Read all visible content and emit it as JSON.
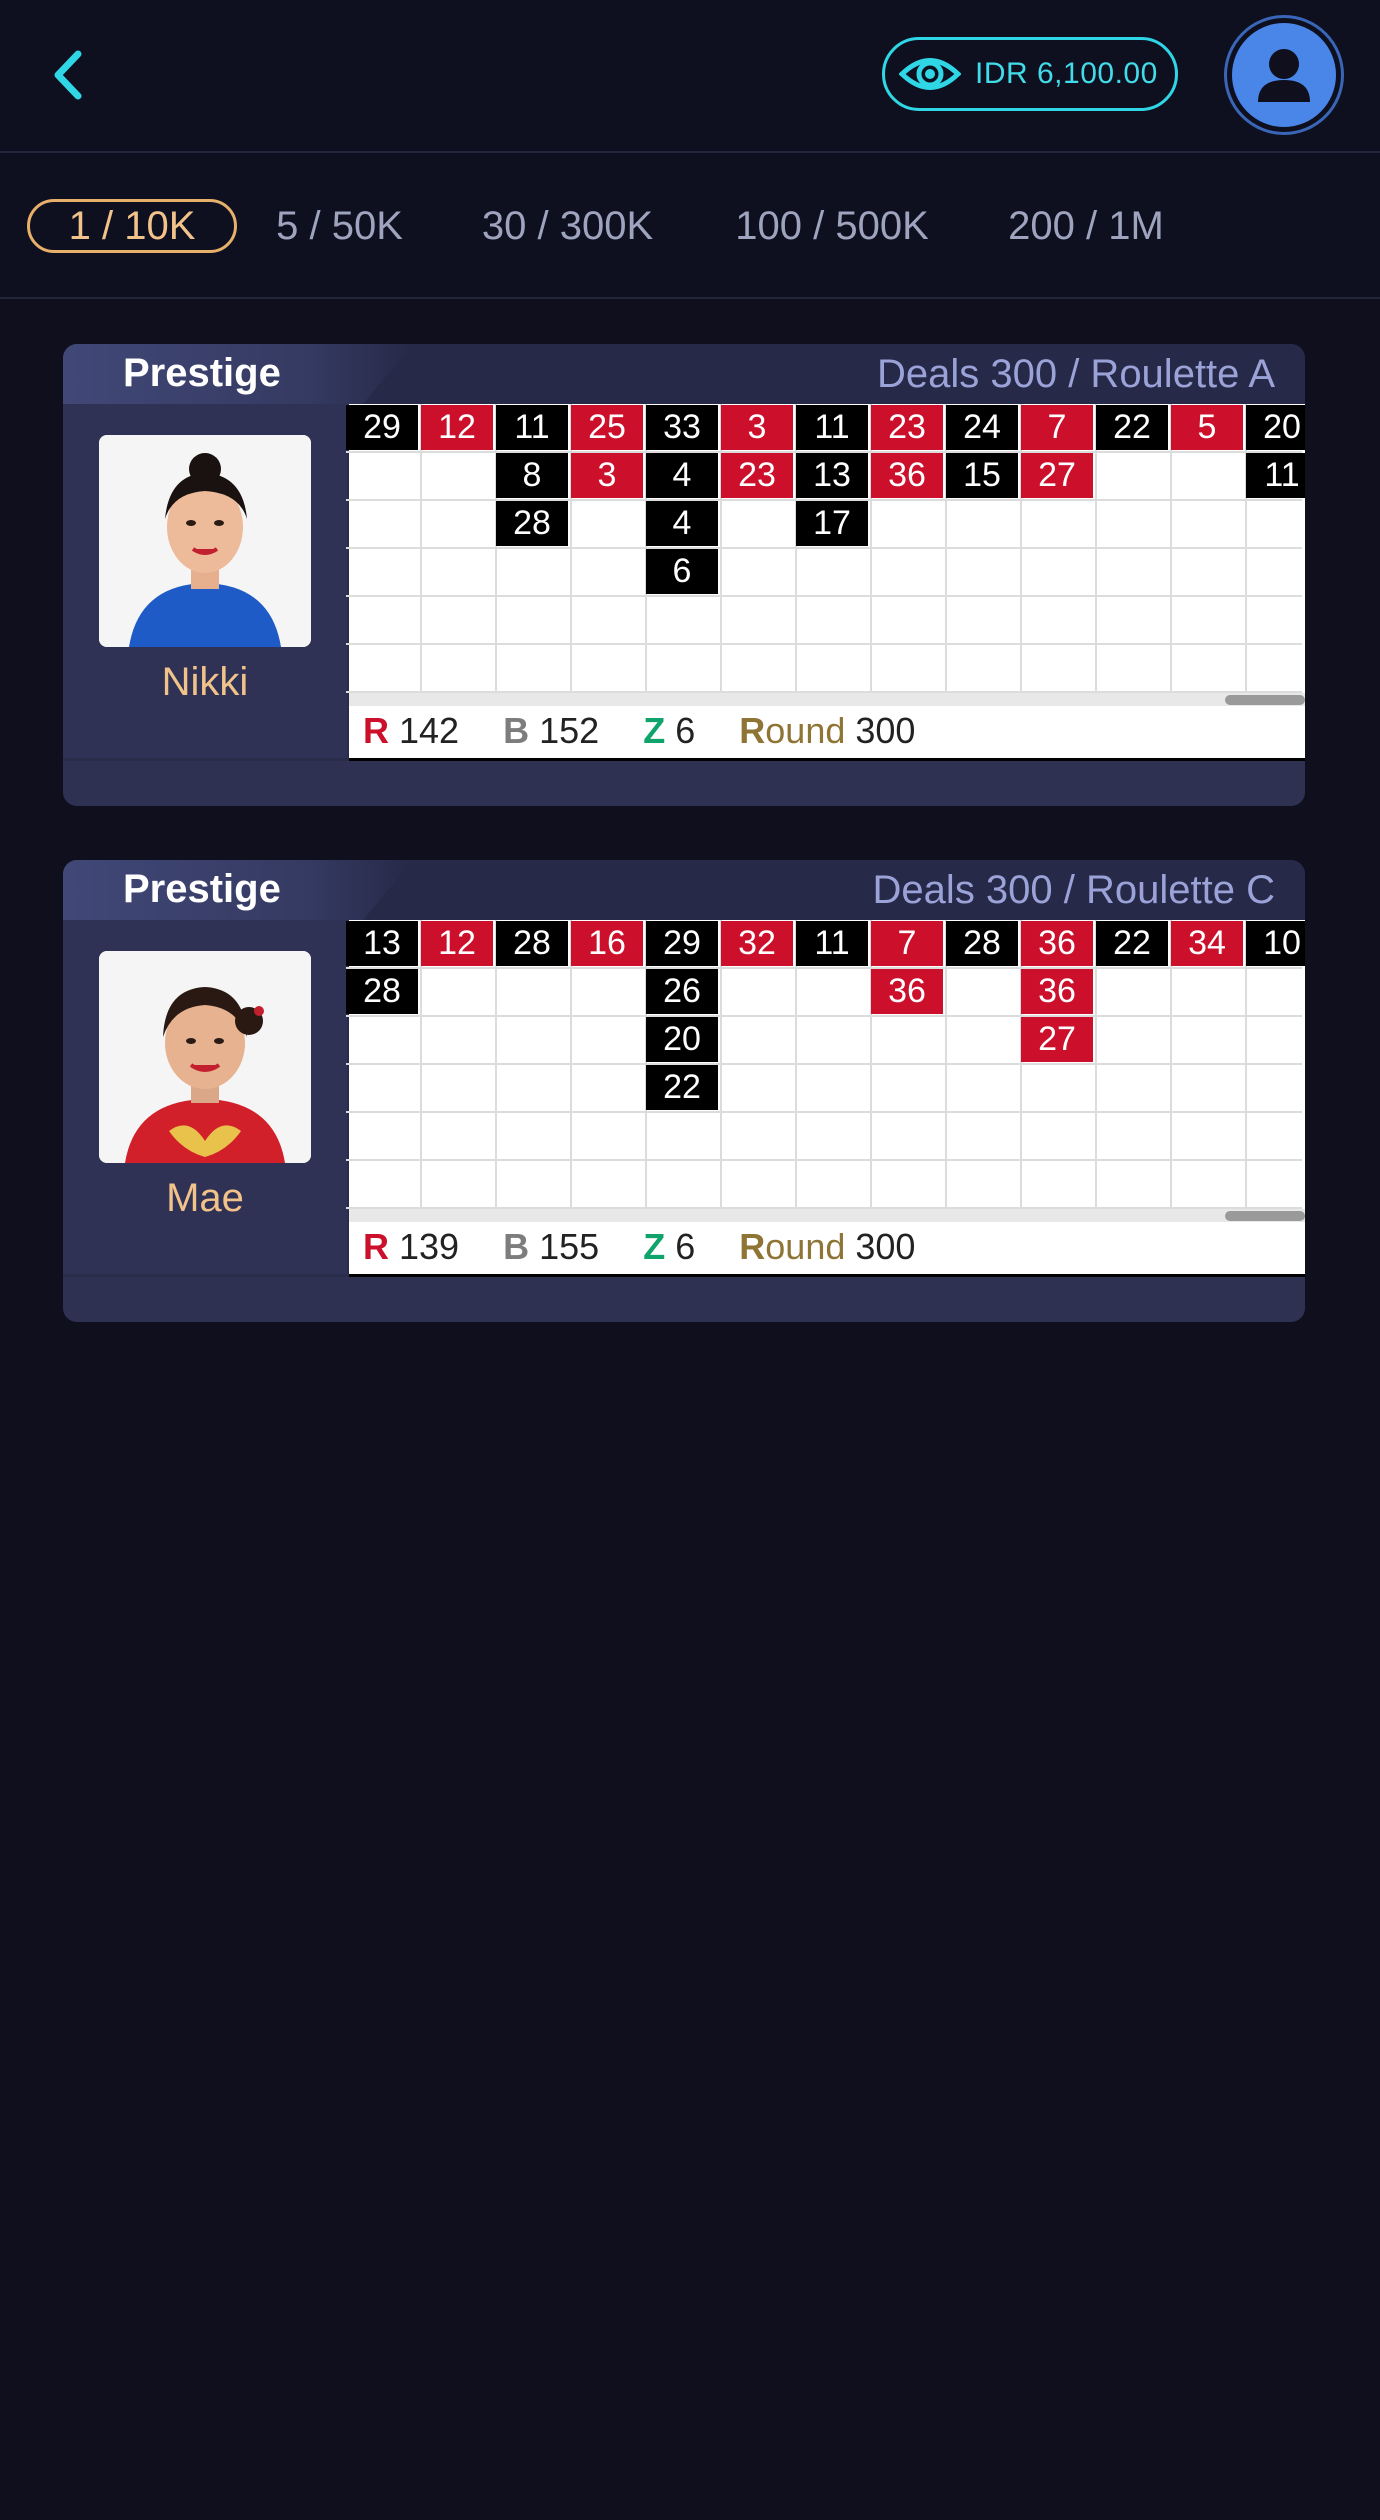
{
  "header": {
    "balance": "IDR  6,100.00"
  },
  "tabs": [
    {
      "label": "1 / 10K",
      "active": true
    },
    {
      "label": "5 / 50K",
      "active": false
    },
    {
      "label": "30 / 300K",
      "active": false
    },
    {
      "label": "100 / 500K",
      "active": false
    },
    {
      "label": "200 / 1M",
      "active": false
    }
  ],
  "tables": [
    {
      "brand": "Prestige",
      "deals": "Deals 300 / Roulette A",
      "dealer": "Nikki",
      "stats": {
        "r_label": "R",
        "r": "142",
        "b_label": "B",
        "b": "152",
        "z_label": "Z",
        "z": "6",
        "round_initial": "R",
        "round_rest": "ound",
        "round": "300"
      },
      "scroll_fraction": 1.0,
      "columns": [
        [
          {
            "n": "29",
            "c": "black"
          }
        ],
        [
          {
            "n": "12",
            "c": "red"
          }
        ],
        [
          {
            "n": "11",
            "c": "black"
          },
          {
            "n": "8",
            "c": "black"
          },
          {
            "n": "28",
            "c": "black"
          }
        ],
        [
          {
            "n": "25",
            "c": "red"
          },
          {
            "n": "3",
            "c": "red"
          }
        ],
        [
          {
            "n": "33",
            "c": "black"
          },
          {
            "n": "4",
            "c": "black"
          },
          {
            "n": "4",
            "c": "black"
          },
          {
            "n": "6",
            "c": "black"
          }
        ],
        [
          {
            "n": "3",
            "c": "red"
          },
          {
            "n": "23",
            "c": "red"
          }
        ],
        [
          {
            "n": "11",
            "c": "black"
          },
          {
            "n": "13",
            "c": "black"
          },
          {
            "n": "17",
            "c": "black"
          }
        ],
        [
          {
            "n": "23",
            "c": "red"
          },
          {
            "n": "36",
            "c": "red"
          }
        ],
        [
          {
            "n": "24",
            "c": "black"
          },
          {
            "n": "15",
            "c": "black"
          }
        ],
        [
          {
            "n": "7",
            "c": "red"
          },
          {
            "n": "27",
            "c": "red"
          }
        ],
        [
          {
            "n": "22",
            "c": "black"
          }
        ],
        [
          {
            "n": "5",
            "c": "red"
          }
        ],
        [
          {
            "n": "20",
            "c": "black"
          },
          {
            "n": "11",
            "c": "black"
          }
        ]
      ]
    },
    {
      "brand": "Prestige",
      "deals": "Deals 300 / Roulette C",
      "dealer": "Mae",
      "stats": {
        "r_label": "R",
        "r": "139",
        "b_label": "B",
        "b": "155",
        "z_label": "Z",
        "z": "6",
        "round_initial": "R",
        "round_rest": "ound",
        "round": "300"
      },
      "scroll_fraction": 1.0,
      "columns": [
        [
          {
            "n": "13",
            "c": "black"
          },
          {
            "n": "28",
            "c": "black"
          }
        ],
        [
          {
            "n": "12",
            "c": "red"
          }
        ],
        [
          {
            "n": "28",
            "c": "black"
          }
        ],
        [
          {
            "n": "16",
            "c": "red"
          }
        ],
        [
          {
            "n": "29",
            "c": "black"
          },
          {
            "n": "26",
            "c": "black"
          },
          {
            "n": "20",
            "c": "black"
          },
          {
            "n": "22",
            "c": "black"
          }
        ],
        [
          {
            "n": "32",
            "c": "red"
          }
        ],
        [
          {
            "n": "11",
            "c": "black"
          }
        ],
        [
          {
            "n": "7",
            "c": "red"
          },
          {
            "n": "36",
            "c": "red"
          }
        ],
        [
          {
            "n": "28",
            "c": "black"
          }
        ],
        [
          {
            "n": "36",
            "c": "red"
          },
          {
            "n": "36",
            "c": "red"
          },
          {
            "n": "27",
            "c": "red"
          }
        ],
        [
          {
            "n": "22",
            "c": "black"
          }
        ],
        [
          {
            "n": "34",
            "c": "red"
          }
        ],
        [
          {
            "n": "10",
            "c": "black"
          }
        ]
      ]
    }
  ],
  "colors": {
    "accent": "#2fd7e6",
    "gold": "#f2c28b",
    "red": "#cc0f2b",
    "black": "#000000",
    "green": "#10a36b"
  }
}
